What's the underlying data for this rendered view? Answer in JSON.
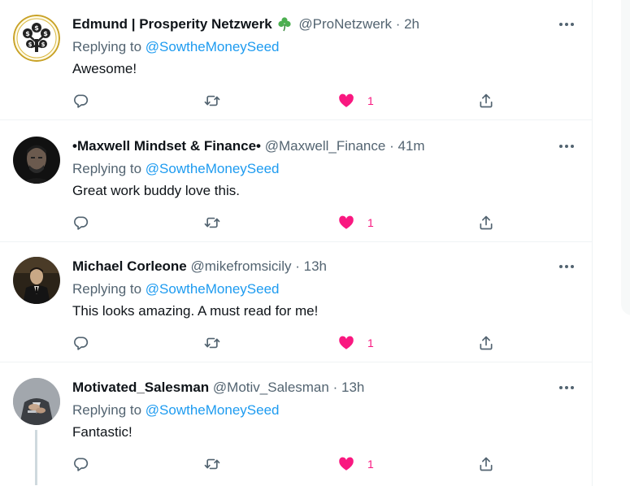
{
  "colors": {
    "accent": "#1d9bf0",
    "like": "#f91880",
    "muted": "#536471",
    "text": "#0f1419",
    "divider": "#eff3f4",
    "shamrock": "#4caf50"
  },
  "icons": {
    "reply": "speech-bubble-icon",
    "retweet": "retweet-arrows-icon",
    "like": "heart-filled-icon",
    "share": "share-upload-icon",
    "more": "more-dots-icon"
  },
  "replies": [
    {
      "name": "Edmund | Prosperity Netzwerk",
      "badge": "shamrock",
      "handle": "@ProNetzwerk",
      "separator": "·",
      "time": "2h",
      "replying_label": "Replying to",
      "replying_to": "@SowtheMoneySeed",
      "text": "Awesome!",
      "likes": "1",
      "liked": true
    },
    {
      "name": "•Maxwell Mindset & Finance•",
      "handle": "@Maxwell_Finance",
      "separator": "·",
      "time": "41m",
      "replying_label": "Replying to",
      "replying_to": "@SowtheMoneySeed",
      "text": "Great work buddy love this.",
      "likes": "1",
      "liked": true
    },
    {
      "name": "Michael Corleone",
      "handle": "@mikefromsicily",
      "separator": "·",
      "time": "13h",
      "replying_label": "Replying to",
      "replying_to": "@SowtheMoneySeed",
      "text": "This looks amazing. A must read for me!",
      "likes": "1",
      "liked": true
    },
    {
      "name": "Motivated_Salesman",
      "handle": "@Motiv_Salesman",
      "separator": "·",
      "time": "13h",
      "replying_label": "Replying to",
      "replying_to": "@SowtheMoneySeed",
      "text": "Fantastic!",
      "likes": "1",
      "liked": true,
      "has_thread_line": true
    }
  ]
}
